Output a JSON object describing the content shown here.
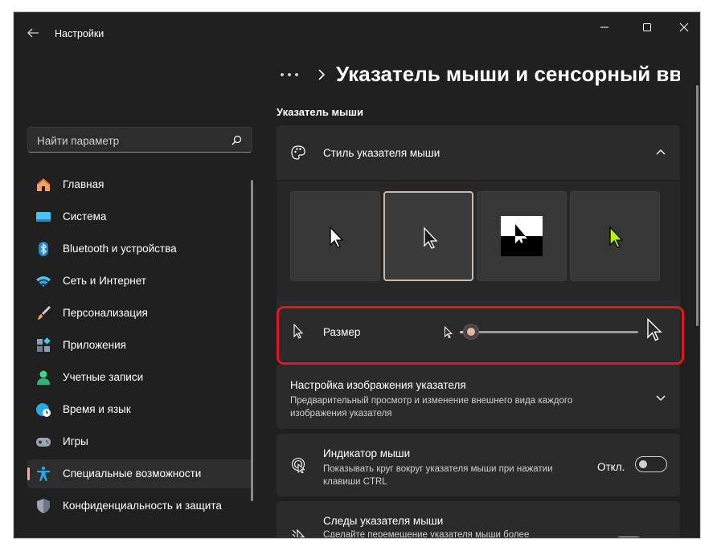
{
  "window": {
    "title": "Настройки"
  },
  "search": {
    "placeholder": "Найти параметр"
  },
  "sidebar": {
    "items": [
      {
        "label": "Главная",
        "icon": "home-icon"
      },
      {
        "label": "Система",
        "icon": "display-icon"
      },
      {
        "label": "Bluetooth и устройства",
        "icon": "bluetooth-icon"
      },
      {
        "label": "Сеть и Интернет",
        "icon": "wifi-icon"
      },
      {
        "label": "Персонализация",
        "icon": "brush-icon"
      },
      {
        "label": "Приложения",
        "icon": "apps-icon"
      },
      {
        "label": "Учетные записи",
        "icon": "account-icon"
      },
      {
        "label": "Время и язык",
        "icon": "globe-clock-icon"
      },
      {
        "label": "Игры",
        "icon": "gamepad-icon"
      },
      {
        "label": "Специальные возможности",
        "icon": "accessibility-icon",
        "active": true
      },
      {
        "label": "Конфиденциальность и защита",
        "icon": "shield-icon"
      }
    ]
  },
  "breadcrumb": {
    "title": "Указатель мыши и сенсорный ввод"
  },
  "section": {
    "title": "Указатель мыши"
  },
  "pointer_style": {
    "label": "Стиль указателя мыши",
    "options": [
      {
        "name": "white",
        "selected": false
      },
      {
        "name": "black",
        "selected": true
      },
      {
        "name": "inverted",
        "selected": false
      },
      {
        "name": "custom",
        "selected": false,
        "color": "#b8f400"
      }
    ]
  },
  "size": {
    "label": "Размер",
    "value": 1,
    "min": 1,
    "max": 15
  },
  "custom_image": {
    "title": "Настройка изображения указателя",
    "description": "Предварительный просмотр и изменение внешнего вида каждого изображения указателя"
  },
  "indicator": {
    "title": "Индикатор мыши",
    "description": "Показывать круг вокруг указателя мыши при нажатии клавиши CTRL",
    "state": "Откл."
  },
  "trails": {
    "title": "Следы указателя мыши",
    "description": "Сделайте перемещение указателя мыши более"
  },
  "colors": {
    "accent": "#e8b5a4",
    "highlight": "#e0181e",
    "background": "#202020"
  }
}
